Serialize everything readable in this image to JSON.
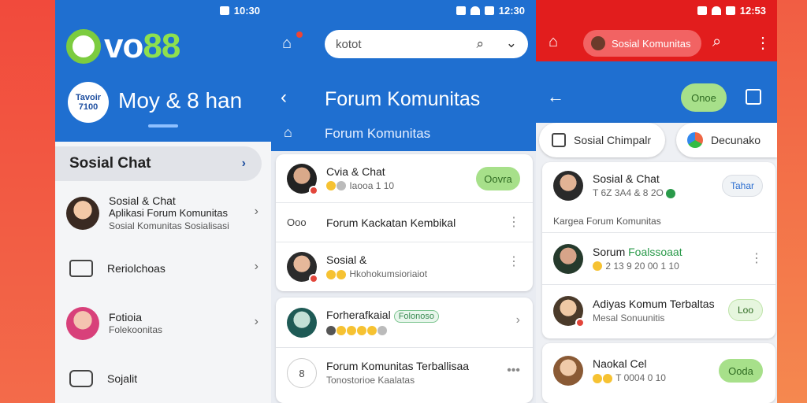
{
  "status": {
    "left_time": "10:30",
    "mid_time": "12:30",
    "right_time": "12:53"
  },
  "phone1": {
    "logo": {
      "ring": "O",
      "word": "vo",
      "num": "88"
    },
    "avatar_text": "Tavoir 7100",
    "user_name": "Moy & 8 han",
    "active_section": "Sosial Chat",
    "items": [
      {
        "title": "Sosial & Chat",
        "line2": "Aplikasi Forum Komunitas",
        "line3": "Sosial Komunitas Sosialisasi"
      },
      {
        "title": "Reriolchoas"
      },
      {
        "title": "Fotioia",
        "line2": "Folekoonitas"
      },
      {
        "title": "Sojalit"
      }
    ]
  },
  "phone2": {
    "search_placeholder": "kotot",
    "title": "Forum Komunitas",
    "subtitle": "Forum Komunitas",
    "card1": [
      {
        "title": "Cvia & Chat",
        "meta": "Iaooa 1 10",
        "button": "Oovra"
      },
      {
        "title": "Forum Kackatan Kembikal",
        "icon": "Ooo"
      },
      {
        "title": "Sosial &",
        "meta": "Hkohokumsioriaiot"
      }
    ],
    "card2": [
      {
        "title": "Forherafkaial",
        "tag": "Folonoso"
      },
      {
        "title": "Forum Komunitas Terballisaa",
        "meta": "Tonostorioe Kaalatas",
        "icon": "8"
      }
    ]
  },
  "phone3": {
    "pill_label": "Sosial Komunitas",
    "join_button": "Onoe",
    "tabs": [
      "Sosial Chimpalr",
      "Decunako"
    ],
    "card1": [
      {
        "title": "Sosial & Chat",
        "meta": "T 6Z 3A4 & 8 2O",
        "button": "Tahar"
      },
      {
        "section": "Kargea Forum Komunitas"
      },
      {
        "title_prefix": "Sorum ",
        "title_accent": "Foalssoaat",
        "meta": "2 13 9 20 00 1 10"
      },
      {
        "title": "Adiyas Komum Terbaltas",
        "meta": "Mesal Sonuunitis",
        "button": "Loo"
      }
    ],
    "card2": [
      {
        "title": "Naokal Cel",
        "meta": "T 0004 0 10",
        "button": "Ooda"
      }
    ]
  },
  "colors": {
    "brand_blue": "#1f6fd0",
    "red_bar": "#e21d1d",
    "green_btn": "#a7e08a",
    "logo_green": "#7ccc3f"
  }
}
